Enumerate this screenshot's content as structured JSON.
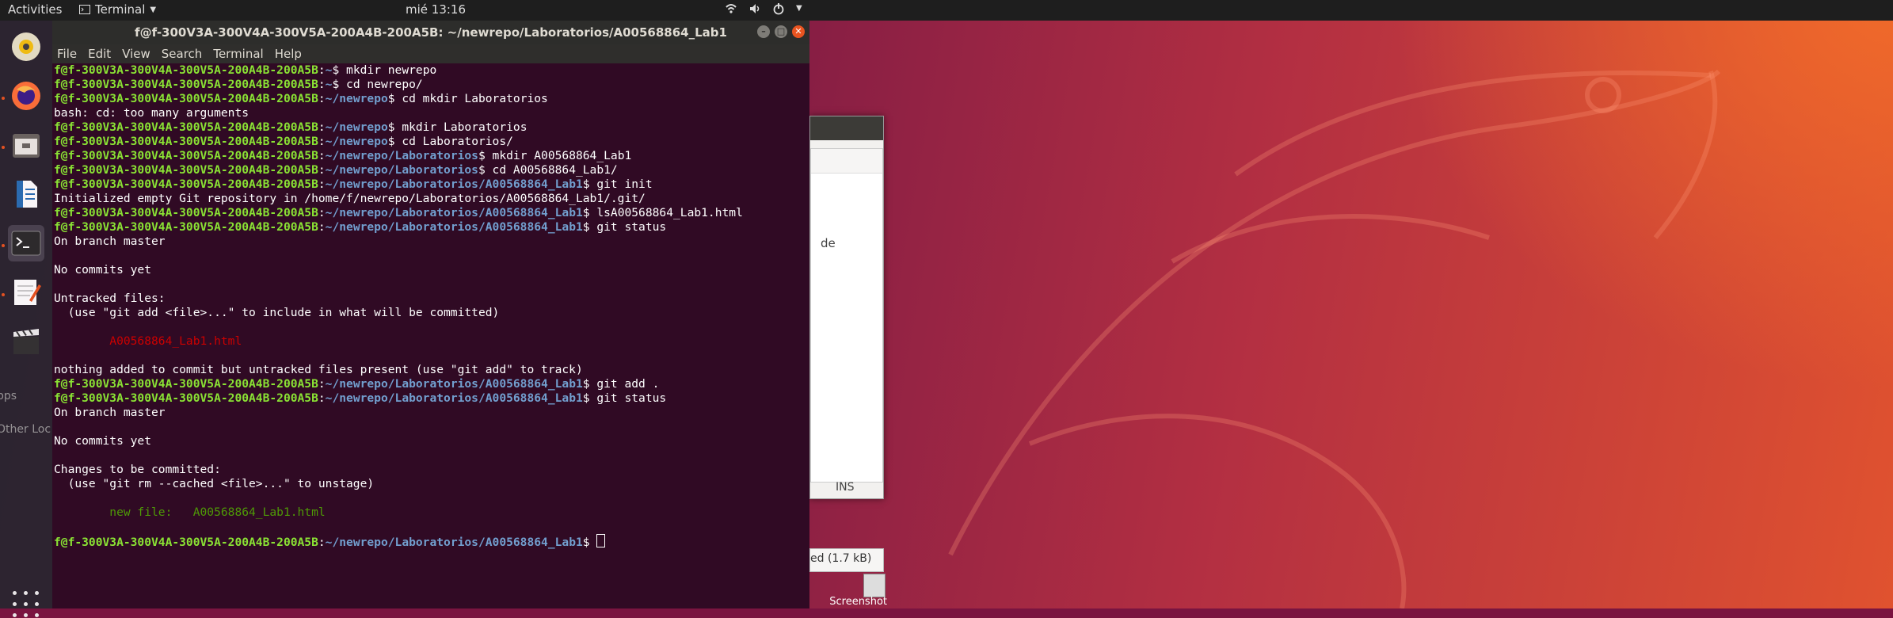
{
  "topbar": {
    "activities": "Activities",
    "app_menu": "Terminal",
    "clock": "mié 13:16"
  },
  "dock": {
    "items": [
      "rhythmbox-icon",
      "firefox-icon",
      "files-icon",
      "libreoffice-writer-icon",
      "terminal-icon",
      "text-editor-icon",
      "video-editor-icon",
      "apps-grid-icon"
    ]
  },
  "background": {
    "win_de_text": "de",
    "win_ins_text": "INS",
    "downloads_text": "ed (1.7 kB)",
    "screenshot_label": "Screenshot",
    "dock_overflow_1": "pps",
    "dock_overflow_2": "Other Loc"
  },
  "terminal": {
    "title": "f@f-300V3A-300V4A-300V5A-200A4B-200A5B: ~/newrepo/Laboratorios/A00568864_Lab1",
    "menu": [
      "File",
      "Edit",
      "View",
      "Search",
      "Terminal",
      "Help"
    ],
    "user_host": "f@f-300V3A-300V4A-300V5A-200A4B-200A5B",
    "lines": [
      {
        "path": "~",
        "cmd": "mkdir newrepo"
      },
      {
        "path": "~",
        "cmd": "cd newrepo/"
      },
      {
        "path": "~/newrepo",
        "cmd": "cd mkdir Laboratorios"
      },
      {
        "text": "bash: cd: too many arguments"
      },
      {
        "path": "~/newrepo",
        "cmd": "mkdir Laboratorios"
      },
      {
        "path": "~/newrepo",
        "cmd": "cd Laboratorios/"
      },
      {
        "path": "~/newrepo/Laboratorios",
        "cmd": "mkdir A00568864_Lab1"
      },
      {
        "path": "~/newrepo/Laboratorios",
        "cmd": "cd A00568864_Lab1/"
      },
      {
        "path": "~/newrepo/Laboratorios/A00568864_Lab1",
        "cmd": "git init"
      },
      {
        "text": "Initialized empty Git repository in /home/f/newrepo/Laboratorios/A00568864_Lab1/.git/"
      },
      {
        "path": "~/newrepo/Laboratorios/A00568864_Lab1",
        "cmd": "lsA00568864_Lab1.html"
      },
      {
        "path": "~/newrepo/Laboratorios/A00568864_Lab1",
        "cmd": "git status"
      },
      {
        "text": "On branch master"
      },
      {
        "text": ""
      },
      {
        "text": "No commits yet"
      },
      {
        "text": ""
      },
      {
        "text": "Untracked files:"
      },
      {
        "text": "  (use \"git add <file>...\" to include in what will be committed)"
      },
      {
        "text": ""
      },
      {
        "text": "        A00568864_Lab1.html",
        "color": "red"
      },
      {
        "text": ""
      },
      {
        "text": "nothing added to commit but untracked files present (use \"git add\" to track)"
      },
      {
        "path": "~/newrepo/Laboratorios/A00568864_Lab1",
        "cmd": "git add ."
      },
      {
        "path": "~/newrepo/Laboratorios/A00568864_Lab1",
        "cmd": "git status"
      },
      {
        "text": "On branch master"
      },
      {
        "text": ""
      },
      {
        "text": "No commits yet"
      },
      {
        "text": ""
      },
      {
        "text": "Changes to be committed:"
      },
      {
        "text": "  (use \"git rm --cached <file>...\" to unstage)"
      },
      {
        "text": ""
      },
      {
        "text": "        new file:   A00568864_Lab1.html",
        "color": "green"
      },
      {
        "text": ""
      },
      {
        "path": "~/newrepo/Laboratorios/A00568864_Lab1",
        "cmd": "",
        "cursor": true
      }
    ]
  },
  "colors": {
    "terminal_bg": "#300a24",
    "prompt_user": "#8ae234",
    "prompt_path": "#729fcf",
    "untracked": "#cc0000",
    "staged": "#4e9a06",
    "ubuntu_orange": "#e95420"
  }
}
